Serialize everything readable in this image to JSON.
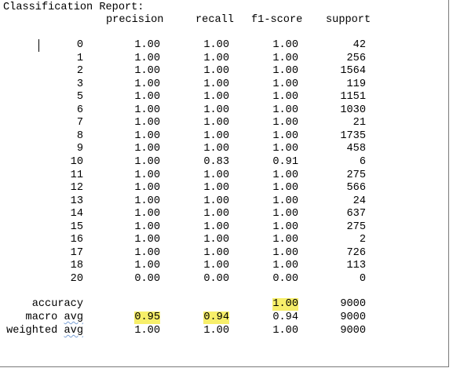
{
  "title": "Classification Report:",
  "headers": {
    "precision": "precision",
    "recall": "recall",
    "f1": "f1-score",
    "support": "support"
  },
  "rows": [
    {
      "label": "0",
      "precision": "1.00",
      "recall": "1.00",
      "f1": "1.00",
      "support": "42"
    },
    {
      "label": "1",
      "precision": "1.00",
      "recall": "1.00",
      "f1": "1.00",
      "support": "256"
    },
    {
      "label": "2",
      "precision": "1.00",
      "recall": "1.00",
      "f1": "1.00",
      "support": "1564"
    },
    {
      "label": "3",
      "precision": "1.00",
      "recall": "1.00",
      "f1": "1.00",
      "support": "119"
    },
    {
      "label": "5",
      "precision": "1.00",
      "recall": "1.00",
      "f1": "1.00",
      "support": "1151"
    },
    {
      "label": "6",
      "precision": "1.00",
      "recall": "1.00",
      "f1": "1.00",
      "support": "1030"
    },
    {
      "label": "7",
      "precision": "1.00",
      "recall": "1.00",
      "f1": "1.00",
      "support": "21"
    },
    {
      "label": "8",
      "precision": "1.00",
      "recall": "1.00",
      "f1": "1.00",
      "support": "1735"
    },
    {
      "label": "9",
      "precision": "1.00",
      "recall": "1.00",
      "f1": "1.00",
      "support": "458"
    },
    {
      "label": "10",
      "precision": "1.00",
      "recall": "0.83",
      "f1": "0.91",
      "support": "6"
    },
    {
      "label": "11",
      "precision": "1.00",
      "recall": "1.00",
      "f1": "1.00",
      "support": "275"
    },
    {
      "label": "12",
      "precision": "1.00",
      "recall": "1.00",
      "f1": "1.00",
      "support": "566"
    },
    {
      "label": "13",
      "precision": "1.00",
      "recall": "1.00",
      "f1": "1.00",
      "support": "24"
    },
    {
      "label": "14",
      "precision": "1.00",
      "recall": "1.00",
      "f1": "1.00",
      "support": "637"
    },
    {
      "label": "15",
      "precision": "1.00",
      "recall": "1.00",
      "f1": "1.00",
      "support": "275"
    },
    {
      "label": "16",
      "precision": "1.00",
      "recall": "1.00",
      "f1": "1.00",
      "support": "2"
    },
    {
      "label": "17",
      "precision": "1.00",
      "recall": "1.00",
      "f1": "1.00",
      "support": "726"
    },
    {
      "label": "18",
      "precision": "1.00",
      "recall": "1.00",
      "f1": "1.00",
      "support": "113"
    },
    {
      "label": "20",
      "precision": "0.00",
      "recall": "0.00",
      "f1": "0.00",
      "support": "0"
    }
  ],
  "summary": {
    "accuracy": {
      "label": "accuracy",
      "f1": "1.00",
      "support": "9000"
    },
    "macro": {
      "label_a": "macro",
      "label_b": "avg",
      "precision": "0.95",
      "recall": "0.94",
      "f1": "0.94",
      "support": "9000"
    },
    "weighted": {
      "label_a": "weighted",
      "label_b": "avg",
      "precision": "1.00",
      "recall": "1.00",
      "f1": "1.00",
      "support": "9000"
    }
  },
  "highlight_color": "#f7ef6a"
}
